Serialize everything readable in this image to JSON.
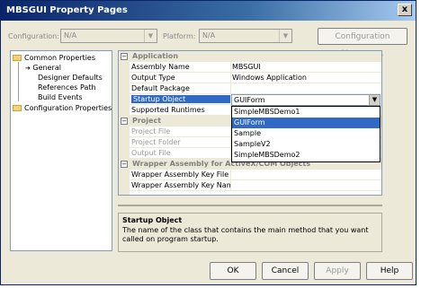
{
  "window": {
    "title": "MBSGUI Property Pages",
    "close": "x"
  },
  "toolbar": {
    "configuration_label": "Configuration:",
    "configuration_value": "N/A",
    "platform_label": "Platform:",
    "platform_value": "N/A",
    "config_manager": "Configuration Manager..."
  },
  "tree": {
    "common": "Common Properties",
    "items": [
      "General",
      "Designer Defaults",
      "References Path",
      "Build Events"
    ],
    "configuration": "Configuration Properties"
  },
  "grid": {
    "cat_application": "Application",
    "rows_app": [
      {
        "name": "Assembly Name",
        "value": "MBSGUI"
      },
      {
        "name": "Output Type",
        "value": "Windows Application"
      },
      {
        "name": "Default Package",
        "value": ""
      },
      {
        "name": "Startup Object",
        "value": ""
      },
      {
        "name": "Supported Runtimes",
        "value": ""
      }
    ],
    "cat_project": "Project",
    "rows_project": [
      {
        "name": "Project File",
        "value": ""
      },
      {
        "name": "Project Folder",
        "value": ""
      },
      {
        "name": "Output File",
        "value": ""
      }
    ],
    "cat_wrapper": "Wrapper Assembly for ActiveX/COM Objects",
    "rows_wrapper": [
      {
        "name": "Wrapper Assembly Key File",
        "value": ""
      },
      {
        "name": "Wrapper Assembly Key Name",
        "value": ""
      }
    ]
  },
  "startup_dropdown": {
    "value": "GUIForm",
    "options": [
      "SimpleMBSDemo1",
      "GUIForm",
      "Sample",
      "SampleV2",
      "SimpleMBSDemo2"
    ],
    "selected_index": 1
  },
  "description": {
    "title": "Startup Object",
    "text": "The name of the class that contains the main method that you want called on program startup."
  },
  "buttons": {
    "ok": "OK",
    "cancel": "Cancel",
    "apply": "Apply",
    "help": "Help"
  }
}
